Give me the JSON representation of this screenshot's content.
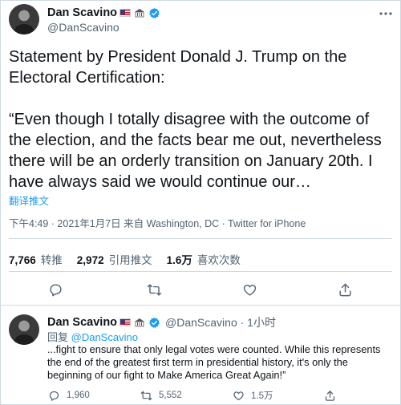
{
  "main_tweet": {
    "name": "Dan Scavino",
    "handle": "@DanScavino",
    "text": "Statement by President Donald J. Trump on the Electoral Certification:\n\n“Even though I totally disagree with the outcome of the election, and the facts bear me out, nevertheless there will be an orderly transition on January 20th. I have always said we would continue our…",
    "translate_label": "翻译推文",
    "meta": "下午4:49 · 2021年1月7日 来自 Washington, DC · Twitter for iPhone",
    "stats": [
      {
        "value": "7,766",
        "label": "转推"
      },
      {
        "value": "2,972",
        "label": "引用推文"
      },
      {
        "value": "1.6万",
        "label": "喜欢次数"
      }
    ],
    "actions": {
      "reply_icon": "comment-icon",
      "retweet_icon": "retweet-icon",
      "like_icon": "heart-icon",
      "share_icon": "share-icon"
    }
  },
  "reply_tweet": {
    "name": "Dan Scavino",
    "handle_time": "@DanScavino · 1小时",
    "reply_prefix": "回复",
    "reply_to": "@DanScavino",
    "text": "...fight to ensure that only legal votes were counted. While this represents the end of the greatest first term in presidential history, it's only the beginning of our fight to Make America Great Again!”",
    "counts": {
      "replies": "1,960",
      "retweets": "5,552",
      "likes": "1.5万"
    }
  },
  "colors": {
    "accent": "#1d9bf0",
    "text": "#0f1419",
    "muted": "#536471",
    "divider": "#cfd9de"
  }
}
